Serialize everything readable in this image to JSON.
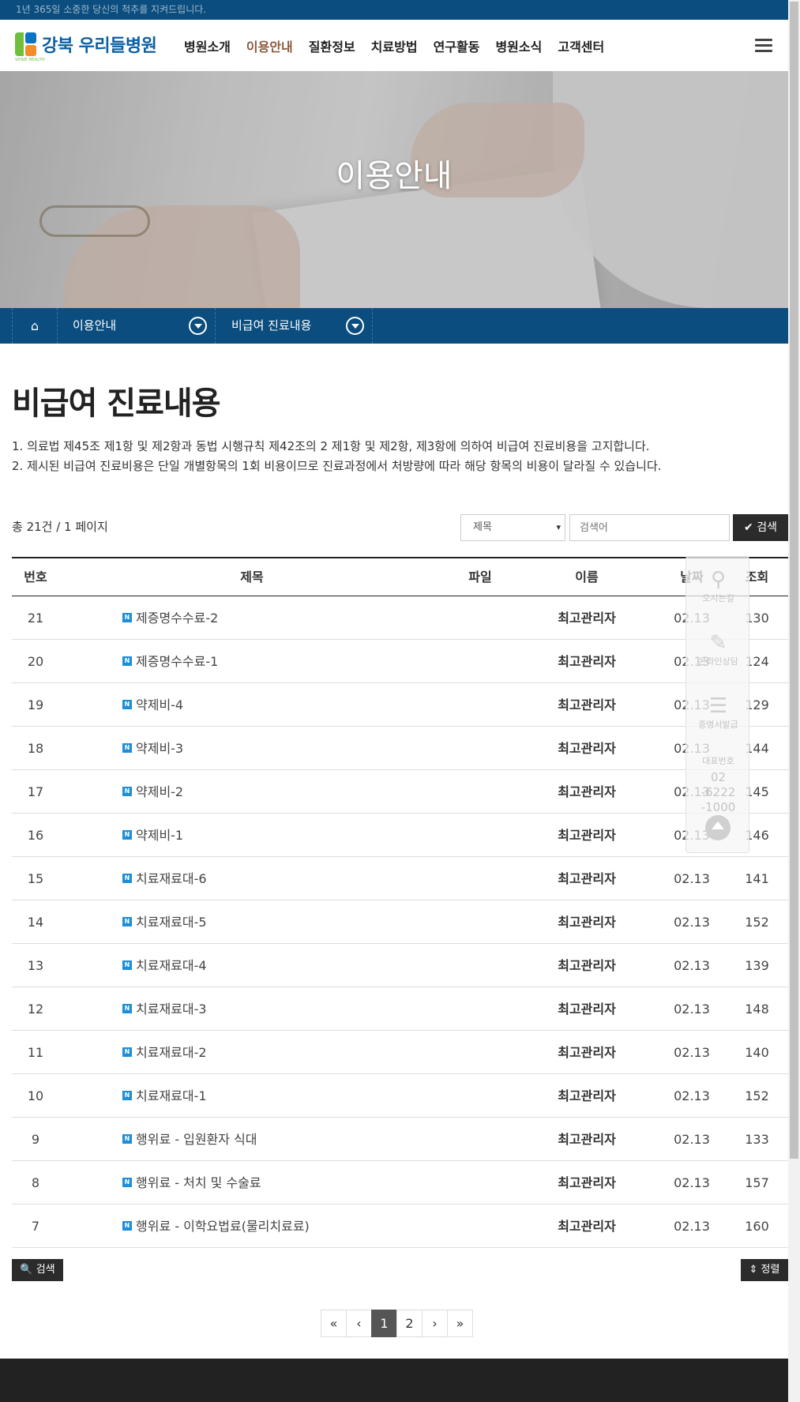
{
  "topbar": {
    "text": "1년 365일 소중한 당신의 척추를 지켜드립니다."
  },
  "logo": {
    "text": "강북 우리들병원",
    "sub": "SPINE HEALTH"
  },
  "nav": {
    "items": [
      {
        "label": "병원소개"
      },
      {
        "label": "이용안내",
        "active": true
      },
      {
        "label": "질환정보"
      },
      {
        "label": "치료방법"
      },
      {
        "label": "연구활동"
      },
      {
        "label": "병원소식"
      },
      {
        "label": "고객센터"
      }
    ]
  },
  "hero": {
    "title": "이용안내"
  },
  "breadcrumb": {
    "level1": "이용안내",
    "level2": "비급여 진료내용"
  },
  "page": {
    "title": "비급여 진료내용",
    "desc1": "1. 의료법 제45조 제1항 및 제2항과 동법 시행규칙 제42조의 2 제1항 및 제2항, 제3항에 의하여 비급여 진료비용을 고지합니다.",
    "desc2": "2. 제시된 비급여 진료비용은 단일 개별항목의 1회 비용이므로 진료과정에서 처방량에 따라 해당 항목의 비용이 달라질 수 있습니다."
  },
  "search": {
    "count_text": "총 21건 / 1 페이지",
    "select_value": "제목",
    "placeholder": "검색어",
    "button": "✔ 검색"
  },
  "table": {
    "headers": {
      "num": "번호",
      "title": "제목",
      "file": "파일",
      "name": "이름",
      "date": "날짜",
      "hits": "조회"
    },
    "rows": [
      {
        "num": "21",
        "title": "제증명수수료-2",
        "name": "최고관리자",
        "date": "02.13",
        "hits": "130"
      },
      {
        "num": "20",
        "title": "제증명수수료-1",
        "name": "최고관리자",
        "date": "02.13",
        "hits": "124"
      },
      {
        "num": "19",
        "title": "약제비-4",
        "name": "최고관리자",
        "date": "02.13",
        "hits": "129"
      },
      {
        "num": "18",
        "title": "약제비-3",
        "name": "최고관리자",
        "date": "02.13",
        "hits": "144"
      },
      {
        "num": "17",
        "title": "약제비-2",
        "name": "최고관리자",
        "date": "02.13",
        "hits": "145"
      },
      {
        "num": "16",
        "title": "약제비-1",
        "name": "최고관리자",
        "date": "02.13",
        "hits": "146"
      },
      {
        "num": "15",
        "title": "치료재료대-6",
        "name": "최고관리자",
        "date": "02.13",
        "hits": "141"
      },
      {
        "num": "14",
        "title": "치료재료대-5",
        "name": "최고관리자",
        "date": "02.13",
        "hits": "152"
      },
      {
        "num": "13",
        "title": "치료재료대-4",
        "name": "최고관리자",
        "date": "02.13",
        "hits": "139"
      },
      {
        "num": "12",
        "title": "치료재료대-3",
        "name": "최고관리자",
        "date": "02.13",
        "hits": "148"
      },
      {
        "num": "11",
        "title": "치료재료대-2",
        "name": "최고관리자",
        "date": "02.13",
        "hits": "140"
      },
      {
        "num": "10",
        "title": "치료재료대-1",
        "name": "최고관리자",
        "date": "02.13",
        "hits": "152"
      },
      {
        "num": "9",
        "title": "행위료 - 입원환자 식대",
        "name": "최고관리자",
        "date": "02.13",
        "hits": "133"
      },
      {
        "num": "8",
        "title": "행위료 - 처치 및 수술료",
        "name": "최고관리자",
        "date": "02.13",
        "hits": "157"
      },
      {
        "num": "7",
        "title": "행위료 - 이학요법료(물리치료료)",
        "name": "최고관리자",
        "date": "02.13",
        "hits": "160"
      }
    ],
    "new_badge": "N"
  },
  "bottom": {
    "search_button": "🔍 검색",
    "sort_button": "⇕ 정렬"
  },
  "pager": {
    "first": "«",
    "prev": "‹",
    "pages": [
      "1",
      "2"
    ],
    "next": "›",
    "last": "»",
    "current": "1"
  },
  "quick_menu": {
    "directions": "오시는길",
    "consult": "온라인상담",
    "certificate": "증명서발급",
    "phone_label": "대표번호",
    "phone_1": "02",
    "phone_2": "-6222",
    "phone_3": "-1000"
  },
  "colors": {
    "brand": "#0a4d7e",
    "active_nav": "#8a5a3c",
    "badge": "#1e8fd6",
    "button": "#2b2b2b"
  }
}
